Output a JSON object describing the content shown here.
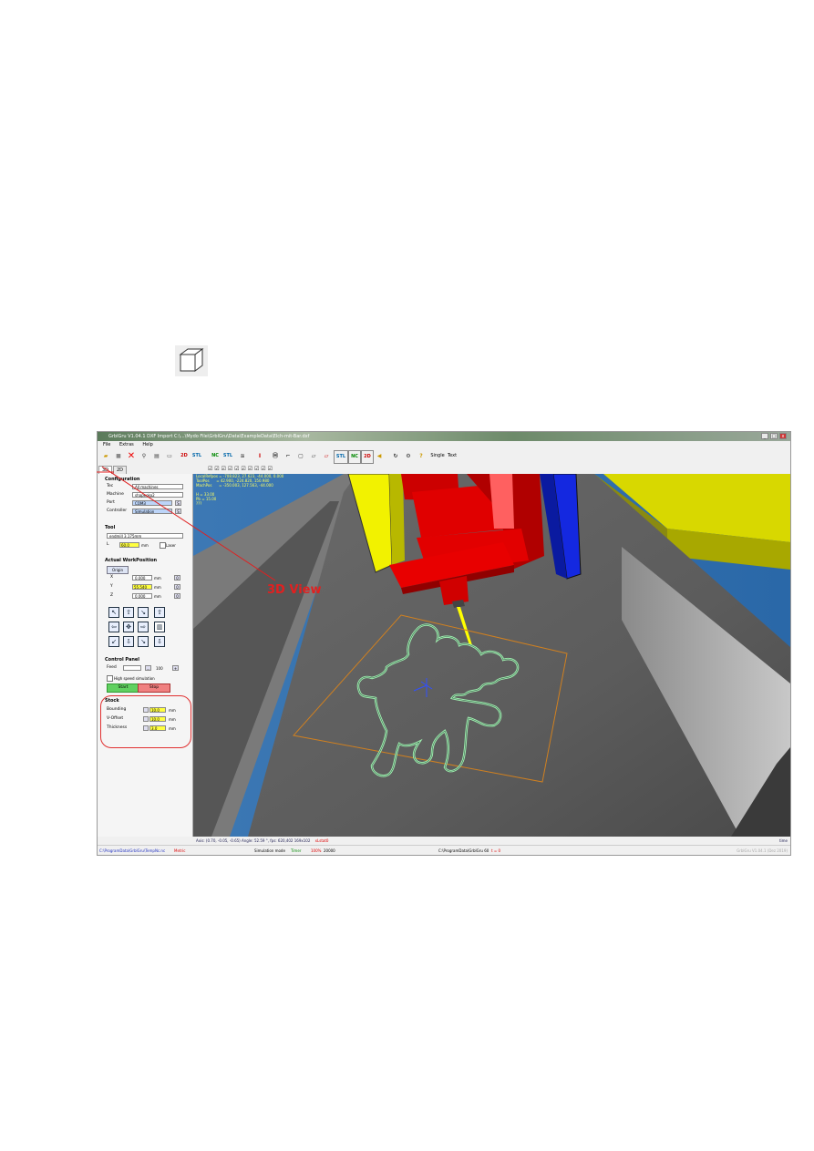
{
  "app": {
    "title": "GrblGru V1.04.1    DXF Import C:\\...\\Mydo File\\GrblGru\\Data\\ExampleData\\Elch-mit-Bar.dxf",
    "window_buttons": [
      "_",
      "□",
      "x"
    ]
  },
  "menu": {
    "items": [
      "File",
      "Extras",
      "Help"
    ]
  },
  "toolbar": {
    "labels": [
      "2D",
      "STL",
      "NC",
      "STL",
      "STL",
      "NC",
      "2D",
      "Single",
      "Text"
    ]
  },
  "tabs": {
    "items": [
      "3D",
      "2D"
    ]
  },
  "sidebar": {
    "configuration": {
      "header": "Configuration",
      "rows": [
        {
          "label": "Tec",
          "value": "All machines"
        },
        {
          "label": "Machine",
          "value": "shapeoko2"
        },
        {
          "label": "Port",
          "value": "COM3"
        },
        {
          "label": "Controller",
          "value": "Simulation"
        }
      ],
      "port_button": "S"
    },
    "tool": {
      "header": "Tool",
      "tool_value": "endmill 3.175mm",
      "length_label": "L",
      "length_value": "60.0",
      "length_unit": "mm",
      "laser_label": "Laser"
    },
    "workposition": {
      "header": "Actual WorkPosition",
      "origin_button": "Origin",
      "axes": [
        {
          "label": "X",
          "value": "0.000",
          "unit": "mm",
          "btn": "0"
        },
        {
          "label": "Y",
          "value": "55.540",
          "unit": "mm",
          "btn": "0"
        },
        {
          "label": "Z",
          "value": "0.000",
          "unit": "mm",
          "btn": "0"
        }
      ],
      "jog_icons": [
        "jog-up-left-icon",
        "jog-up-icon",
        "jog-z-up-icon",
        "jog-home-icon",
        "jog-left-icon",
        "jog-center-icon",
        "jog-right-icon",
        "jog-trash-icon",
        "jog-down-left-icon",
        "jog-down-icon",
        "jog-z-down-icon",
        "jog-down-right-icon"
      ]
    },
    "control_panel": {
      "header": "Control Panel",
      "feed_label": "Feed",
      "feed_value": "100",
      "feed_minus": "...",
      "feed_plus": "+",
      "hs_label": "High speed simulation",
      "start_label": "Start",
      "stop_label": "Stop"
    },
    "stock": {
      "header": "Stock",
      "rows": [
        {
          "label": "Bounding",
          "value": "10.0",
          "unit": "mm"
        },
        {
          "label": "V-Offset",
          "value": "10.0",
          "unit": "mm"
        },
        {
          "label": "Thickness",
          "value": "3.0",
          "unit": "mm"
        }
      ]
    }
  },
  "view": {
    "info_lines": [
      "LocalRefpos = -708.823, 27.623, -44.000, 0.000",
      "ToolPos      = 42.900, -224.820, 150.980",
      "MachPos      = -350.003, 127.563, -44.000",
      "",
      "H = 33.00",
      "Pb = 15.00",
      "???"
    ]
  },
  "status": {
    "line1_left": "Axis: (0.70, -0.05, -0.65) Angle: 52.59 °, fps: 620,402  169x102",
    "line1_red": "xLstat0",
    "line1_right": "time",
    "path": "C:\\ProgramData\\GrblGru\\TempNc.nc",
    "metric": "Metric",
    "mode": "Simulation mode",
    "timer": "Timer",
    "percent": "100%",
    "count": "20000",
    "data_path": "C:\\ProgramData\\GrblGru 60",
    "t_value": "t = 0",
    "version": "GrblGru V1.04.1 (Dez 2019)"
  },
  "annotation": {
    "label": "3D View",
    "color": "#e02020"
  }
}
